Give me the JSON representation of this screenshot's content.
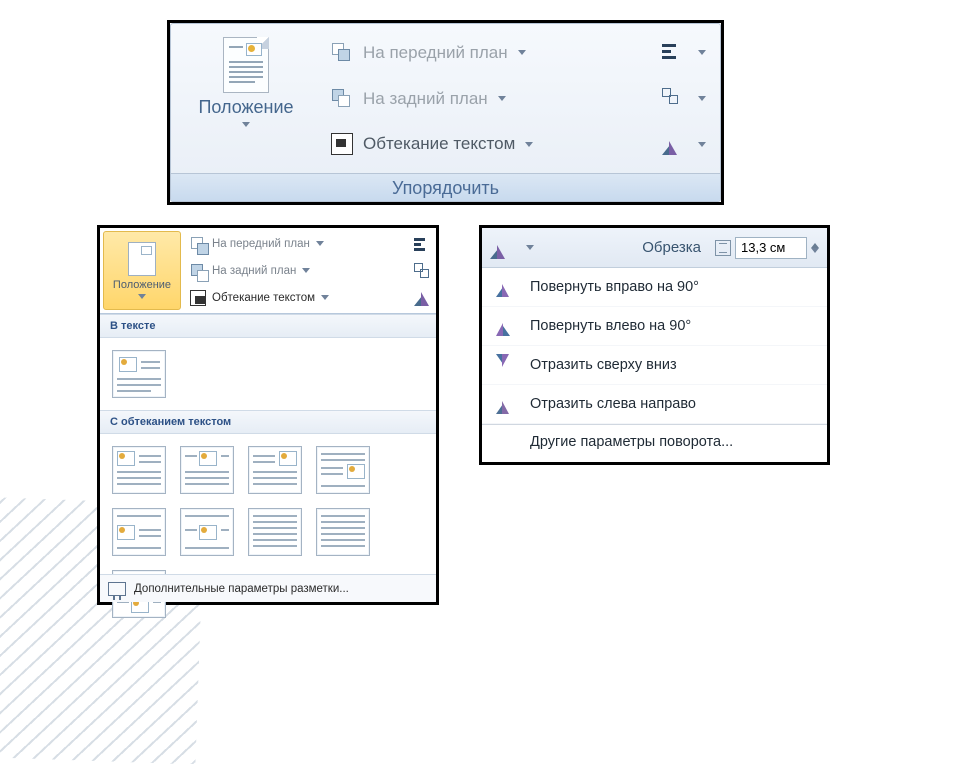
{
  "panel1": {
    "group_label": "Упорядочить",
    "position_label": "Положение",
    "cmd1": "На передний план",
    "cmd2": "На задний план",
    "cmd3": "Обтекание текстом"
  },
  "panel2": {
    "position_label": "Положение",
    "cmd1": "На передний план",
    "cmd2": "На задний план",
    "cmd3": "Обтекание текстом",
    "section_inline": "В тексте",
    "section_wrap": "С обтеканием текстом",
    "footer": "Дополнительные параметры разметки..."
  },
  "panel3": {
    "crop_label": "Обрезка",
    "size_value": "13,3 см",
    "m1": "Повернуть вправо на 90°",
    "m2": "Повернуть влево на 90°",
    "m3": "Отразить сверху вниз",
    "m4": "Отразить слева направо",
    "m5": "Другие параметры поворота..."
  }
}
